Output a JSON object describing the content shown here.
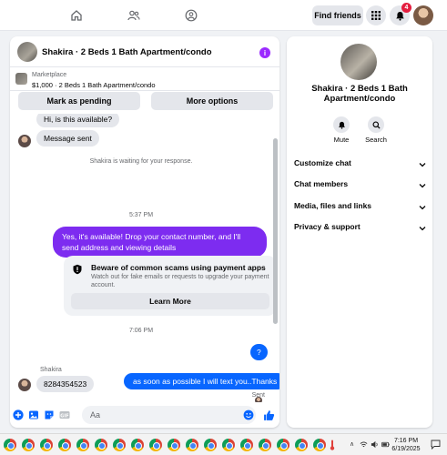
{
  "topbar": {
    "find_friends_label": "Find friends",
    "notification_count": "4"
  },
  "chat": {
    "title": "Shakira · 2 Beds 1 Bath Apartment/condo",
    "listing_category": "Marketplace",
    "listing_detail": "$1,000 · 2 Beds 1 Bath Apartment/condo",
    "mark_pending_label": "Mark as pending",
    "more_options_label": "More options",
    "messages": {
      "incoming_1": "Hi, is this available?",
      "incoming_2": "Message sent",
      "waiting_notice": "Shakira is waiting for your response.",
      "time_1": "5:37 PM",
      "outgoing_1": "Yes, it's available! Drop your contact number, and I'll send address and viewing details",
      "warning_title": "Beware of common scams using payment apps",
      "warning_text": "Watch out for fake emails or requests to upgrade your payment account.",
      "learn_more_label": "Learn More",
      "time_2": "7:06 PM",
      "outgoing_2": "?",
      "sender_name": "Shakira",
      "incoming_3": "8284354523",
      "outgoing_3": "as soon as possible I will text you..Thanks",
      "sent_status": "Sent"
    },
    "composer_placeholder": "Aa"
  },
  "sidebar": {
    "title": "Shakira · 2 Beds 1 Bath Apartment/condo",
    "mute_label": "Mute",
    "search_label": "Search",
    "sections": [
      "Customize chat",
      "Chat members",
      "Media, files and links",
      "Privacy & support"
    ]
  },
  "taskbar": {
    "time": "7:16 PM",
    "date": "6/19/2025"
  },
  "colors": {
    "accent_purple": "#7d2cf0",
    "accent_blue": "#0866ff",
    "badge_red": "#e41e3f"
  }
}
